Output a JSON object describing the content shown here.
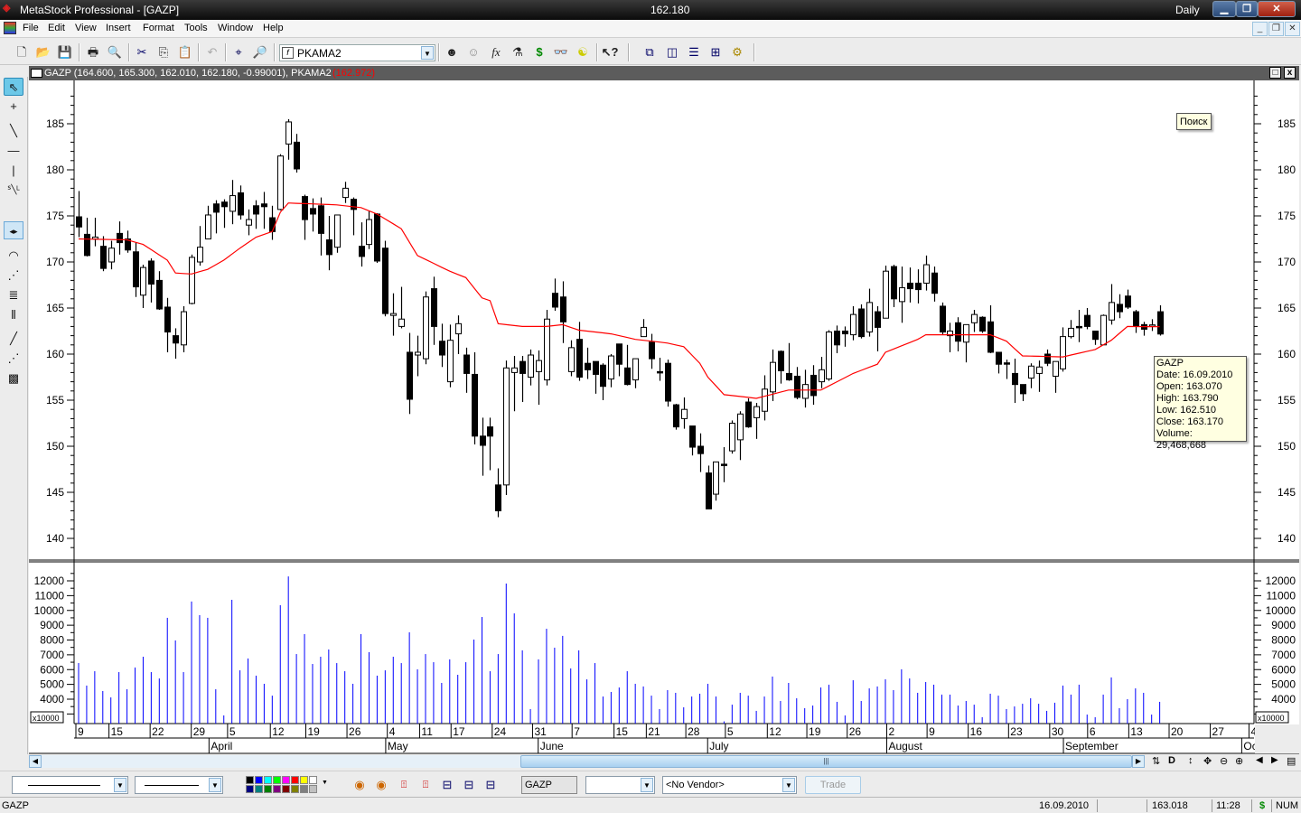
{
  "window": {
    "title": "MetaStock Professional - [GAZP]",
    "last_price": "162.180",
    "periodicity": "Daily",
    "app_logo": "MS"
  },
  "menu": [
    "File",
    "Edit",
    "View",
    "Insert",
    "Format",
    "Tools",
    "Window",
    "Help"
  ],
  "toolbar": {
    "indicator_select": "PKAMA2"
  },
  "chart_window": {
    "legend": "GAZP (164.600, 165.300, 162.010, 162.180, -0.99001), PKAMA2 ",
    "pkama_value": "(162.972)"
  },
  "search_tooltip": "Поиск",
  "data_tooltip": [
    "GAZP",
    "Date: 16.09.2010",
    "Open: 163.070",
    "High: 163.790",
    "Low: 162.510",
    "Close: 163.170",
    "Volume: 29,468,668"
  ],
  "bottom_toolbar": {
    "symbol": "GAZP",
    "vendor": "<No Vendor>",
    "trade": "Trade",
    "palette": [
      "#000000",
      "#0000ff",
      "#00ffff",
      "#00ff00",
      "#ff00ff",
      "#ff0000",
      "#ffff00",
      "#ffffff",
      "#000080",
      "#008080",
      "#008000",
      "#800080",
      "#800000",
      "#808000",
      "#808080",
      "#c0c0c0"
    ]
  },
  "status": {
    "symbol": "GAZP",
    "date": "16.09.2010",
    "value": "163.018",
    "time": "11:28",
    "currency": "$",
    "num": "NUM"
  },
  "colors": {
    "pkama": "#ff0000",
    "volume": "#0000ff",
    "pkama_value": "#ff0000",
    "currency": "#008000"
  },
  "chart_data": {
    "type": "candlestick",
    "symbol": "GAZP",
    "ylim": [
      138,
      189
    ],
    "y_ticks": [
      140,
      145,
      150,
      155,
      160,
      165,
      170,
      175,
      180,
      185
    ],
    "volume_ticks": [
      4000,
      5000,
      6000,
      7000,
      8000,
      9000,
      10000,
      11000,
      12000
    ],
    "volume_multiplier": "x10000",
    "xlim": [
      -0.5,
      145.7
    ],
    "day_ticks": [
      [
        "9",
        0
      ],
      [
        "15",
        4.1
      ],
      [
        "22",
        9.2
      ],
      [
        "29",
        14.3
      ],
      [
        "5",
        18.8
      ],
      [
        "12",
        24.1
      ],
      [
        "19",
        28.5
      ],
      [
        "26",
        33.6
      ],
      [
        "4",
        38.6
      ],
      [
        "11",
        42.6
      ],
      [
        "17",
        46.5
      ],
      [
        "24",
        51.6
      ],
      [
        "31",
        56.6
      ],
      [
        "7",
        61.5
      ],
      [
        "15",
        66.7
      ],
      [
        "21",
        70.7
      ],
      [
        "28",
        75.6
      ],
      [
        "5",
        80.5
      ],
      [
        "12",
        85.7
      ],
      [
        "19",
        90.6
      ],
      [
        "26",
        95.6
      ],
      [
        "2",
        100.5
      ],
      [
        "9",
        105.5
      ],
      [
        "16",
        110.6
      ],
      [
        "23",
        115.6
      ],
      [
        "30",
        120.7
      ],
      [
        "6",
        125.4
      ],
      [
        "13",
        130.5
      ],
      [
        "20",
        135.5
      ],
      [
        "27",
        140.6
      ],
      [
        "4",
        145.4
      ]
    ],
    "month_ticks": [
      [
        "April",
        16.5
      ],
      [
        "May",
        38.4
      ],
      [
        "June",
        57.3
      ],
      [
        "July",
        78.3
      ],
      [
        "August",
        100.5
      ],
      [
        "September",
        122.4
      ],
      [
        "Oc",
        144.5
      ]
    ],
    "ohlc": [
      [
        174.9,
        177.7,
        172.7,
        173.8
      ],
      [
        173,
        174.8,
        170.6,
        170.7
      ],
      [
        172.5,
        174.8,
        171.7,
        172.7
      ],
      [
        171.7,
        172.8,
        169,
        169.3
      ],
      [
        170,
        172.3,
        169.2,
        171.5
      ],
      [
        173.1,
        174.4,
        170.8,
        172.1
      ],
      [
        172.5,
        173.4,
        171,
        171.3
      ],
      [
        171.1,
        172.1,
        166.2,
        167.3
      ],
      [
        166.4,
        169.7,
        165,
        169.4
      ],
      [
        170.1,
        170.4,
        165.6,
        167.6
      ],
      [
        168,
        169,
        164.8,
        164.9
      ],
      [
        165.1,
        166.1,
        160.2,
        162.4
      ],
      [
        162,
        162.8,
        159.5,
        161.2
      ],
      [
        161,
        165.2,
        160.2,
        164.6
      ],
      [
        165.5,
        170.8,
        165.4,
        170.5
      ],
      [
        170,
        173.9,
        169.6,
        171.6
      ],
      [
        172.5,
        176.1,
        172.5,
        175.1
      ],
      [
        176.3,
        176.7,
        173.1,
        175.4
      ],
      [
        176.5,
        176.8,
        173.7,
        176
      ],
      [
        175.5,
        178.9,
        174.1,
        177.2
      ],
      [
        177.5,
        178.3,
        174.6,
        175.1
      ],
      [
        174,
        175.7,
        172.9,
        174.6
      ],
      [
        176.1,
        176.7,
        173.6,
        175.2
      ],
      [
        176.3,
        177.6,
        173.6,
        176
      ],
      [
        174.8,
        176.1,
        172.4,
        173.3
      ],
      [
        175.7,
        181.7,
        175.6,
        181.5
      ],
      [
        182.8,
        185.5,
        181.1,
        185.2
      ],
      [
        183,
        183.9,
        179.7,
        180.1
      ],
      [
        177.1,
        177.3,
        172.4,
        174.6
      ],
      [
        175.8,
        176.9,
        173.3,
        175.2
      ],
      [
        176.1,
        177,
        170.7,
        173.1
      ],
      [
        172.4,
        175,
        169.1,
        170.8
      ],
      [
        171.6,
        175.1,
        171,
        175.1
      ],
      [
        177,
        178.7,
        176.4,
        178
      ],
      [
        176.8,
        177,
        172.9,
        175.7
      ],
      [
        171.7,
        174.3,
        169.5,
        170.6
      ],
      [
        171.9,
        175.5,
        171.4,
        174.6
      ],
      [
        175.2,
        175.3,
        169.9,
        170.1
      ],
      [
        171.5,
        172.3,
        164.1,
        164.4
      ],
      [
        164.2,
        166.6,
        162,
        164.4
      ],
      [
        163,
        167.3,
        162.8,
        163.8
      ],
      [
        160.2,
        162.3,
        153.5,
        155.1
      ],
      [
        159.9,
        162,
        157.6,
        160.2
      ],
      [
        159.5,
        166.8,
        158.9,
        166.2
      ],
      [
        167.1,
        168.4,
        161,
        163
      ],
      [
        161.4,
        163.3,
        158.6,
        159.9
      ],
      [
        157,
        163.2,
        156.4,
        161.5
      ],
      [
        162.2,
        164.2,
        160,
        163.3
      ],
      [
        159.9,
        160.7,
        155.8,
        157.9
      ],
      [
        157.8,
        160.2,
        150.2,
        151.1
      ],
      [
        151.1,
        153.1,
        146.8,
        150.1
      ],
      [
        152.1,
        153.1,
        147.4,
        151.1
      ],
      [
        145.8,
        147.6,
        142.3,
        143
      ],
      [
        145.8,
        159.3,
        144.7,
        158.5
      ],
      [
        158,
        159.8,
        153.8,
        158.5
      ],
      [
        159.2,
        159.8,
        154.8,
        157.9
      ],
      [
        157.5,
        160.5,
        156.6,
        159.9
      ],
      [
        158.1,
        160.4,
        154.5,
        159.3
      ],
      [
        157.2,
        164.8,
        156.6,
        163.8
      ],
      [
        166.6,
        168.2,
        164.7,
        165.1
      ],
      [
        166.2,
        167.9,
        161.2,
        163.5
      ],
      [
        158.1,
        161.5,
        157.6,
        160.7
      ],
      [
        161.6,
        163.5,
        157.1,
        157.5
      ],
      [
        159,
        160.7,
        157.3,
        158.3
      ],
      [
        159.2,
        159.2,
        155.7,
        157.8
      ],
      [
        158.8,
        159,
        155,
        156.5
      ],
      [
        157.3,
        160,
        156.4,
        159.8
      ],
      [
        161.1,
        161.1,
        157.6,
        158.9
      ],
      [
        158.5,
        161,
        156.6,
        156.7
      ],
      [
        157.2,
        159.5,
        156.3,
        159.5
      ],
      [
        161.9,
        163.8,
        161.9,
        162.9
      ],
      [
        161.3,
        162.2,
        158.4,
        159.5
      ],
      [
        158.1,
        159.6,
        157.1,
        158
      ],
      [
        159,
        159.4,
        154.3,
        154.9
      ],
      [
        154.5,
        154.6,
        151.8,
        152.1
      ],
      [
        153,
        155.3,
        151.9,
        154
      ],
      [
        152.2,
        152.2,
        149,
        149.9
      ],
      [
        150,
        151.4,
        147.2,
        149.2
      ],
      [
        147.1,
        147.9,
        143.2,
        143.2
      ],
      [
        144.8,
        148.3,
        144.1,
        148.3
      ],
      [
        148.05,
        149.9,
        146.1,
        148
      ],
      [
        149.5,
        152.8,
        149.2,
        152.5
      ],
      [
        150.7,
        153.8,
        148.5,
        153.5
      ],
      [
        154.8,
        155.2,
        152,
        152.1
      ],
      [
        153.1,
        154.7,
        150.8,
        154.3
      ],
      [
        153.8,
        157.7,
        152.8,
        156.2
      ],
      [
        155.9,
        160.5,
        154.9,
        159.1
      ],
      [
        160.3,
        160.4,
        156.8,
        158.2
      ],
      [
        157.9,
        161.2,
        157.1,
        157.2
      ],
      [
        157.6,
        158.6,
        155.1,
        155.3
      ],
      [
        155.2,
        158.3,
        154.2,
        156.7
      ],
      [
        157.7,
        158.8,
        154.5,
        155.5
      ],
      [
        157,
        159.7,
        156.3,
        158.3
      ],
      [
        157.3,
        162.6,
        157.1,
        162.4
      ],
      [
        162.5,
        163.1,
        160.1,
        161
      ],
      [
        162.5,
        163,
        160.8,
        162.2
      ],
      [
        162.1,
        165.2,
        161.5,
        164.3
      ],
      [
        164.9,
        165.4,
        161.7,
        161.9
      ],
      [
        162.4,
        167.1,
        161.9,
        165.6
      ],
      [
        164.6,
        165.2,
        160.3,
        162.9
      ],
      [
        163.9,
        169.6,
        163.9,
        169
      ],
      [
        169.5,
        169.7,
        165.1,
        166
      ],
      [
        165.7,
        169.5,
        163.4,
        167.2
      ],
      [
        167.7,
        169.4,
        165.6,
        167.1
      ],
      [
        167.7,
        169.2,
        165.5,
        167
      ],
      [
        167.7,
        170.7,
        166.9,
        169.7
      ],
      [
        168.8,
        169.5,
        165.7,
        166.6
      ],
      [
        165.2,
        165.6,
        162.1,
        162.4
      ],
      [
        162,
        163.4,
        160.2,
        162.5
      ],
      [
        163.4,
        164,
        160.3,
        161.4
      ],
      [
        161.3,
        163.2,
        159.1,
        163.2
      ],
      [
        163.4,
        164.8,
        162.4,
        164.3
      ],
      [
        164,
        164.1,
        162.3,
        162.5
      ],
      [
        163.5,
        165.3,
        160.1,
        160.2
      ],
      [
        160.2,
        160.2,
        157.9,
        158.9
      ],
      [
        159.05,
        159.4,
        157.3,
        159
      ],
      [
        157.9,
        159.5,
        154.7,
        156.7
      ],
      [
        156.7,
        156.7,
        154.9,
        155.7
      ],
      [
        157.4,
        159,
        156.3,
        158.7
      ],
      [
        157.9,
        159.3,
        155.9,
        158.6
      ],
      [
        160,
        160.5,
        158.7,
        159
      ],
      [
        157.6,
        159.2,
        155.8,
        159.2
      ],
      [
        158.4,
        162.9,
        158.1,
        161.9
      ],
      [
        161.9,
        163.7,
        161.7,
        162.8
      ],
      [
        163,
        164.8,
        161.3,
        162.9
      ],
      [
        164.2,
        165,
        162.7,
        163
      ],
      [
        162.5,
        162.5,
        161,
        161.6
      ],
      [
        161,
        164.3,
        161,
        164.2
      ],
      [
        163.7,
        167.6,
        163.2,
        165.6
      ],
      [
        165.4,
        166.5,
        163.9,
        164.6
      ],
      [
        166.3,
        167,
        164.9,
        165.1
      ],
      [
        164.6,
        164.8,
        162.3,
        163
      ],
      [
        163.2,
        163.5,
        162,
        162.7
      ],
      [
        163.07,
        163.79,
        162.51,
        163.17
      ],
      [
        164.6,
        165.3,
        162.01,
        162.18
      ]
    ],
    "volume": [
      6440,
      4920,
      5890,
      4550,
      4120,
      5830,
      4670,
      6140,
      6870,
      5830,
      5400,
      9500,
      7970,
      5830,
      10600,
      9680,
      9500,
      4670,
      2900,
      10720,
      5950,
      6750,
      5590,
      5040,
      4240,
      10350,
      12300,
      7050,
      8400,
      6380,
      6870,
      7360,
      6440,
      5890,
      5040,
      8400,
      7180,
      5590,
      5950,
      6870,
      6440,
      8520,
      6020,
      7050,
      6500,
      5100,
      6690,
      5650,
      6500,
      8030,
      9560,
      5890,
      7050,
      11820,
      9800,
      7300,
      3330,
      6690,
      8760,
      7480,
      8280,
      6080,
      7300,
      5340,
      6440,
      4180,
      4490,
      4790,
      5890,
      5040,
      4860,
      4240,
      3330,
      4610,
      4430,
      3450,
      4180,
      4370,
      5040,
      4180,
      2500,
      3630,
      4430,
      4240,
      3210,
      4180,
      5530,
      3880,
      5100,
      4060,
      3390,
      3570,
      4790,
      4980,
      3820,
      2900,
      5280,
      3880,
      4730,
      4860,
      5340,
      4610,
      6020,
      5400,
      4430,
      5160,
      4980,
      4310,
      4310,
      3570,
      3880,
      3630,
      2780,
      4370,
      4240,
      3330,
      3510,
      3690,
      4060,
      3690,
      3210,
      3760,
      4920,
      4310,
      4980,
      2960,
      2780,
      4310,
      5470,
      3390,
      4000,
      4730,
      4430,
      2960,
      3820
    ],
    "pkama_keypoints": [
      [
        0,
        172.5
      ],
      [
        6,
        172.4
      ],
      [
        8,
        171.9
      ],
      [
        11,
        170.2
      ],
      [
        12,
        168.8
      ],
      [
        14,
        168.7
      ],
      [
        16,
        169.2
      ],
      [
        18,
        170.2
      ],
      [
        20,
        171.5
      ],
      [
        22,
        172.7
      ],
      [
        24,
        173.3
      ],
      [
        25,
        175.4
      ],
      [
        26,
        176.4
      ],
      [
        32,
        176.2
      ],
      [
        35,
        175.9
      ],
      [
        37,
        175.2
      ],
      [
        40,
        173.6
      ],
      [
        42,
        170.7
      ],
      [
        46,
        169
      ],
      [
        48,
        168.3
      ],
      [
        50,
        166.1
      ],
      [
        51,
        165.8
      ],
      [
        52,
        163.3
      ],
      [
        55,
        163
      ],
      [
        58,
        163
      ],
      [
        60,
        163.2
      ],
      [
        62,
        162.6
      ],
      [
        66,
        162.2
      ],
      [
        69,
        161.6
      ],
      [
        73,
        161.2
      ],
      [
        75,
        160.8
      ],
      [
        77,
        159
      ],
      [
        78,
        157.5
      ],
      [
        80,
        155.6
      ],
      [
        84,
        155.2
      ],
      [
        88,
        156.1
      ],
      [
        92,
        156.1
      ],
      [
        96,
        157.9
      ],
      [
        99,
        158.9
      ],
      [
        100,
        160.2
      ],
      [
        104,
        161.6
      ],
      [
        105,
        162.1
      ],
      [
        113,
        162.1
      ],
      [
        115,
        161.4
      ],
      [
        117,
        159.8
      ],
      [
        122,
        159.7
      ],
      [
        126,
        160.5
      ],
      [
        128,
        161.5
      ],
      [
        130,
        163
      ],
      [
        134,
        162.97
      ]
    ]
  }
}
